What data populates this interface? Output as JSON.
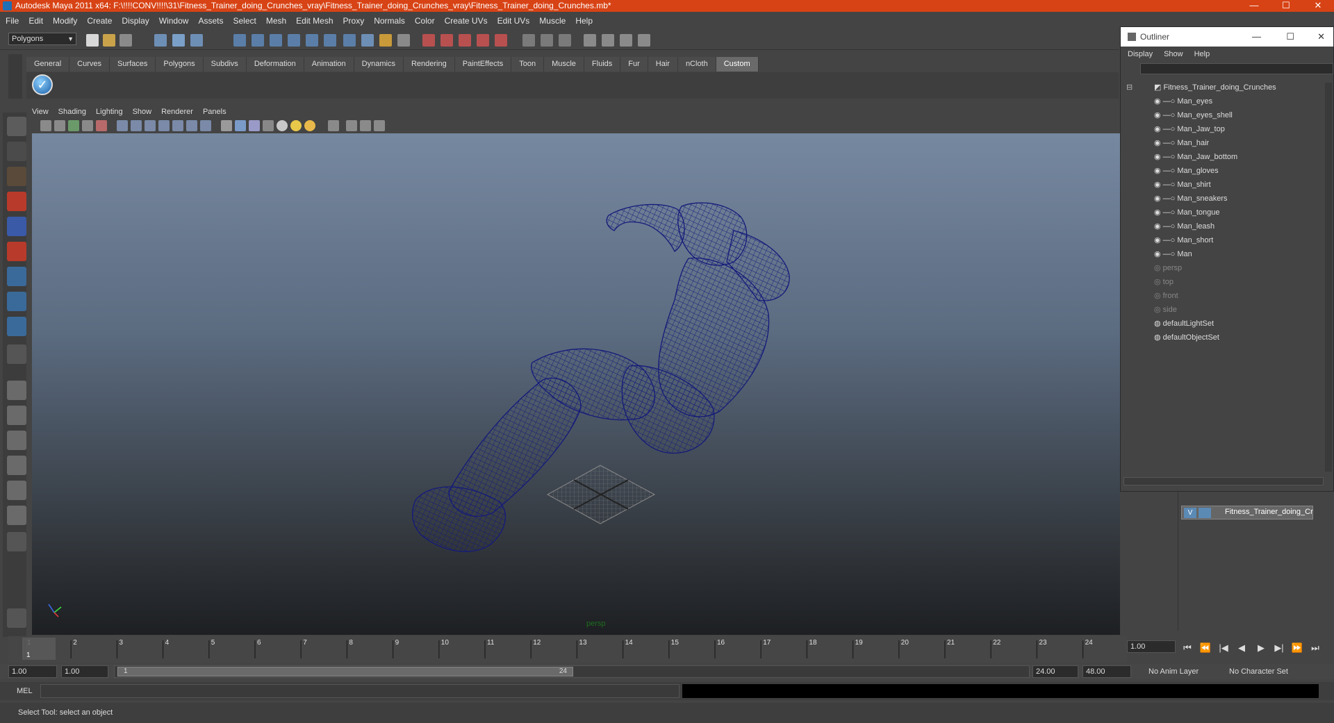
{
  "window": {
    "title": "Autodesk Maya 2011 x64: F:\\!!!!CONV!!!!\\31\\Fitness_Trainer_doing_Crunches_vray\\Fitness_Trainer_doing_Crunches_vray\\Fitness_Trainer_doing_Crunches.mb*",
    "minimize": "—",
    "maximize": "☐",
    "close": "✕"
  },
  "menubar": [
    "File",
    "Edit",
    "Modify",
    "Create",
    "Display",
    "Window",
    "Assets",
    "Select",
    "Mesh",
    "Edit Mesh",
    "Proxy",
    "Normals",
    "Color",
    "Create UVs",
    "Edit UVs",
    "Muscle",
    "Help"
  ],
  "toolbar": {
    "mode": "Polygons"
  },
  "shelf_tabs": [
    "General",
    "Curves",
    "Surfaces",
    "Polygons",
    "Subdivs",
    "Deformation",
    "Animation",
    "Dynamics",
    "Rendering",
    "PaintEffects",
    "Toon",
    "Muscle",
    "Fluids",
    "Fur",
    "Hair",
    "nCloth",
    "Custom"
  ],
  "shelf_active": "Custom",
  "panel_menu": [
    "View",
    "Shading",
    "Lighting",
    "Show",
    "Renderer",
    "Panels"
  ],
  "viewport": {
    "camera": "persp",
    "wire_color": "#141a7a"
  },
  "outliner": {
    "title": "Outliner",
    "menu": [
      "Display",
      "Show",
      "Help"
    ],
    "root": "Fitness_Trainer_doing_Crunches",
    "children": [
      "Man_eyes",
      "Man_eyes_shell",
      "Man_Jaw_top",
      "Man_hair",
      "Man_Jaw_bottom",
      "Man_gloves",
      "Man_shirt",
      "Man_sneakers",
      "Man_tongue",
      "Man_leash",
      "Man_short",
      "Man"
    ],
    "cameras": [
      "persp",
      "top",
      "front",
      "side"
    ],
    "sets": [
      "defaultLightSet",
      "defaultObjectSet"
    ]
  },
  "layers": {
    "visible": "V",
    "name": "Fitness_Trainer_doing_Cr"
  },
  "timeslider": {
    "ticks": [
      "1",
      "2",
      "3",
      "4",
      "5",
      "6",
      "7",
      "8",
      "9",
      "10",
      "11",
      "12",
      "13",
      "14",
      "15",
      "16",
      "17",
      "18",
      "19",
      "20",
      "21",
      "22",
      "23",
      "24"
    ],
    "current_label": "1",
    "current_time": "1.00"
  },
  "playback": [
    "⏮",
    "⏪",
    "|◀",
    "◀",
    "▶",
    "▶|",
    "⏩",
    "⏭"
  ],
  "range": {
    "start": "1.00",
    "start2": "1.00",
    "slider_start": "1",
    "slider_end": "24",
    "end": "24.00",
    "end2": "48.00",
    "anim_layer": "No Anim Layer",
    "char_set": "No Character Set"
  },
  "mel": {
    "label": "MEL"
  },
  "status": {
    "text": "Select Tool: select an object"
  }
}
